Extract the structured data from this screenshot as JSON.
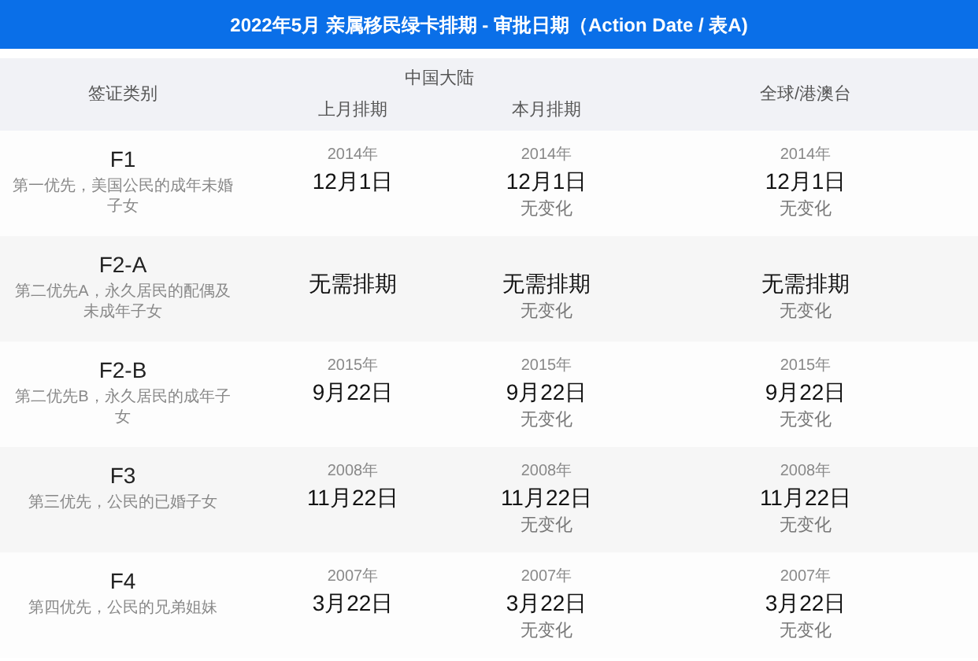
{
  "title": "2022年5月 亲属移民绿卡排期 - 审批日期（Action Date / 表A)",
  "header": {
    "category": "签证类别",
    "group": "中国大陆",
    "columns": [
      "上月排期",
      "本月排期"
    ],
    "global": "全球/港澳台"
  },
  "rows": [
    {
      "category": "F1",
      "description": "第一优先，美国公民的成年未婚子女",
      "cells": [
        {
          "year": "2014年",
          "date": "12月1日"
        },
        {
          "year": "2014年",
          "date": "12月1日",
          "change": "无变化"
        },
        {
          "year": "2014年",
          "date": "12月1日",
          "change": "无变化"
        }
      ]
    },
    {
      "category": "F2-A",
      "description": "第二优先A，永久居民的配偶及未成年子女",
      "cells": [
        {
          "date": "无需排期"
        },
        {
          "date": "无需排期",
          "change": "无变化"
        },
        {
          "date": "无需排期",
          "change": "无变化"
        }
      ]
    },
    {
      "category": "F2-B",
      "description": "第二优先B，永久居民的成年子女",
      "cells": [
        {
          "year": "2015年",
          "date": "9月22日"
        },
        {
          "year": "2015年",
          "date": "9月22日",
          "change": "无变化"
        },
        {
          "year": "2015年",
          "date": "9月22日",
          "change": "无变化"
        }
      ]
    },
    {
      "category": "F3",
      "description": "第三优先，公民的已婚子女",
      "cells": [
        {
          "year": "2008年",
          "date": "11月22日"
        },
        {
          "year": "2008年",
          "date": "11月22日",
          "change": "无变化"
        },
        {
          "year": "2008年",
          "date": "11月22日",
          "change": "无变化"
        }
      ]
    },
    {
      "category": "F4",
      "description": "第四优先，公民的兄弟姐妹",
      "cells": [
        {
          "year": "2007年",
          "date": "3月22日"
        },
        {
          "year": "2007年",
          "date": "3月22日",
          "change": "无变化"
        },
        {
          "year": "2007年",
          "date": "3月22日",
          "change": "无变化"
        }
      ]
    }
  ]
}
